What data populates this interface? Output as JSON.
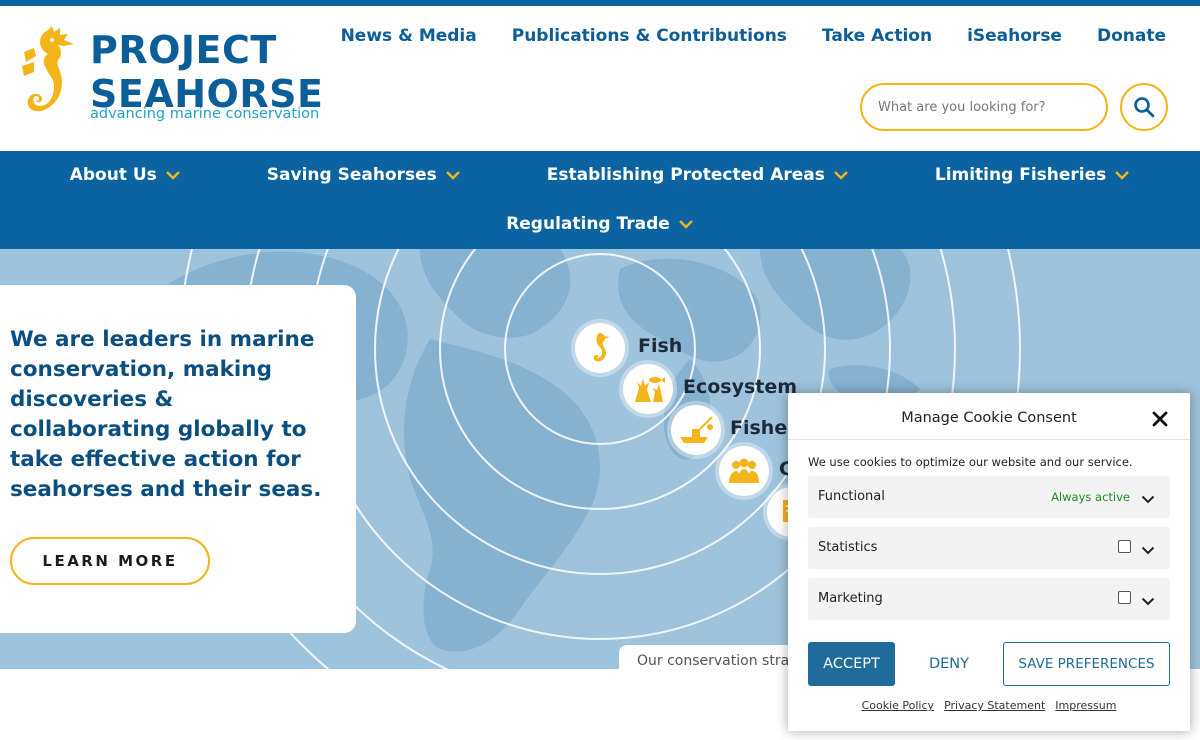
{
  "brand": {
    "title_line1": "PROJECT",
    "title_line2": "SEAHORSE",
    "tagline": "advancing marine conservation",
    "logo_icon": "seahorse-icon",
    "colors": {
      "navy": "#0b5e97",
      "gold": "#f4b41a",
      "teal": "#1fa3c6",
      "nav_bg": "#0b64a1",
      "hero_bg": "#9ec4dd"
    }
  },
  "top_nav": [
    {
      "label": "News & Media"
    },
    {
      "label": "Publications & Contributions"
    },
    {
      "label": "Take Action"
    },
    {
      "label": "iSeahorse"
    },
    {
      "label": "Donate"
    }
  ],
  "search": {
    "placeholder": "What are you looking for?",
    "button_icon": "search-icon"
  },
  "main_nav": {
    "row1": [
      {
        "label": "About Us"
      },
      {
        "label": "Saving Seahorses"
      },
      {
        "label": "Establishing Protected Areas"
      },
      {
        "label": "Limiting Fisheries"
      }
    ],
    "row2": [
      {
        "label": "Regulating Trade"
      }
    ],
    "chevron_icon": "chevron-down-icon"
  },
  "hero": {
    "headline": "We are leaders in marine conservation, making discoveries & collaborating globally to take effective action for seahorses and their seas.",
    "cta": "LEARN MORE",
    "rings": [
      {
        "label": "Fish",
        "icon": "seahorse-icon"
      },
      {
        "label": "Ecosystem",
        "icon": "coral-fish-icon"
      },
      {
        "label": "Fisher",
        "icon": "fishing-boat-icon"
      },
      {
        "label": "C",
        "icon": "community-icon"
      },
      {
        "label": "",
        "icon": "document-icon"
      }
    ],
    "strategy_tab": "Our conservation strat"
  },
  "cookie": {
    "title": "Manage Cookie Consent",
    "description": "We use cookies to optimize our website and our service.",
    "categories": [
      {
        "name": "Functional",
        "status": "Always active"
      },
      {
        "name": "Statistics",
        "status": ""
      },
      {
        "name": "Marketing",
        "status": ""
      }
    ],
    "accept": "ACCEPT",
    "deny": "DENY",
    "save": "SAVE PREFERENCES",
    "links": [
      "Cookie Policy",
      "Privacy Statement",
      "Impressum"
    ]
  }
}
